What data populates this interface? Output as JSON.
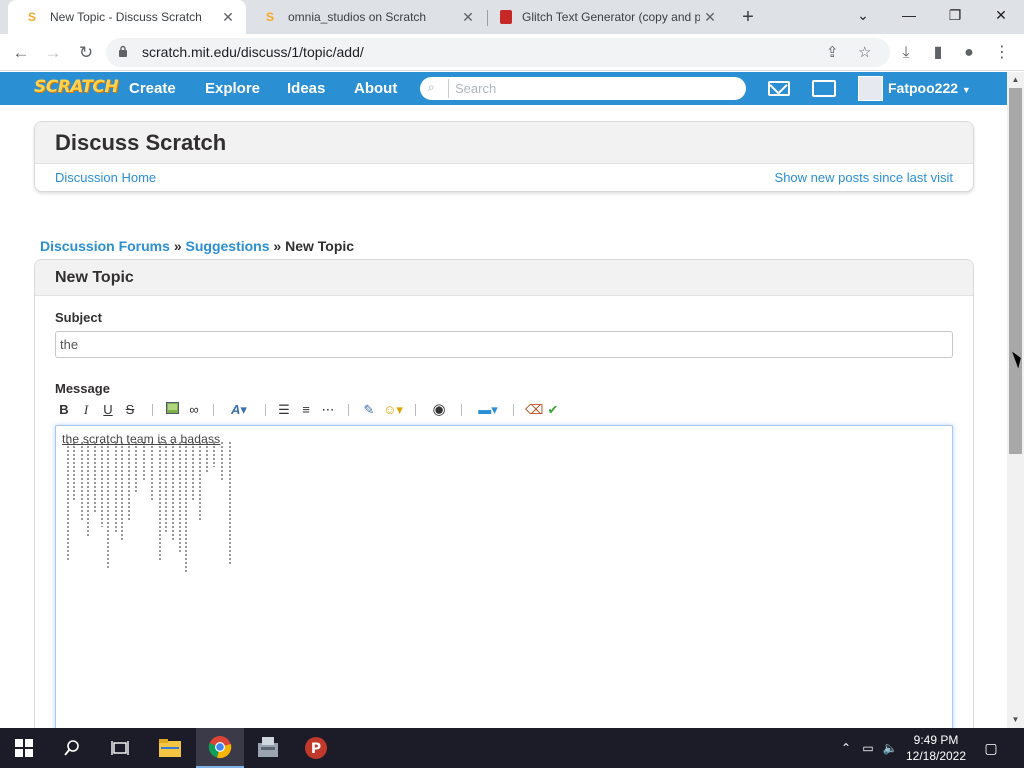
{
  "browser": {
    "tabs": [
      {
        "title": "New Topic - Discuss Scratch",
        "active": true
      },
      {
        "title": "omnia_studios on Scratch",
        "active": false
      },
      {
        "title": "Glitch Text Generator (copy and p",
        "active": false
      }
    ],
    "url": "scratch.mit.edu/discuss/1/topic/add/"
  },
  "nav": {
    "logo": "SCRATCH",
    "links": [
      "Create",
      "Explore",
      "Ideas",
      "About"
    ],
    "search_placeholder": "Search",
    "username": "Fatpoo222",
    "accent": "#2b8fd4"
  },
  "discuss": {
    "title": "Discuss Scratch",
    "home_link": "Discussion Home",
    "new_posts_link": "Show new posts since last visit"
  },
  "breadcrumb": {
    "forums": "Discussion Forums",
    "sep": "»",
    "category": "Suggestions",
    "current": "New Topic"
  },
  "new_topic": {
    "heading": "New Topic",
    "subject_label": "Subject",
    "subject_value": "the",
    "message_label": "Message",
    "message_text": "the scratch team is a badass"
  },
  "taskbar": {
    "time": "9:49 PM",
    "date": "12/18/2022"
  }
}
